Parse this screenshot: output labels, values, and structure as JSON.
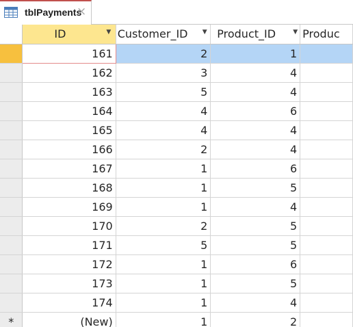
{
  "tab": {
    "label": "tblPayments",
    "close_symbol": "×",
    "icon": "table-icon"
  },
  "columns": [
    {
      "label": "ID"
    },
    {
      "label": "Customer_ID"
    },
    {
      "label": "Product_ID"
    },
    {
      "label": "Produc"
    }
  ],
  "rows": [
    {
      "id": "161",
      "customer_id": "2",
      "product_id": "1"
    },
    {
      "id": "162",
      "customer_id": "3",
      "product_id": "4"
    },
    {
      "id": "163",
      "customer_id": "5",
      "product_id": "4"
    },
    {
      "id": "164",
      "customer_id": "4",
      "product_id": "6"
    },
    {
      "id": "165",
      "customer_id": "4",
      "product_id": "4"
    },
    {
      "id": "166",
      "customer_id": "2",
      "product_id": "4"
    },
    {
      "id": "167",
      "customer_id": "1",
      "product_id": "6"
    },
    {
      "id": "168",
      "customer_id": "1",
      "product_id": "5"
    },
    {
      "id": "169",
      "customer_id": "1",
      "product_id": "4"
    },
    {
      "id": "170",
      "customer_id": "2",
      "product_id": "5"
    },
    {
      "id": "171",
      "customer_id": "5",
      "product_id": "5"
    },
    {
      "id": "172",
      "customer_id": "1",
      "product_id": "6"
    },
    {
      "id": "173",
      "customer_id": "1",
      "product_id": "5"
    },
    {
      "id": "174",
      "customer_id": "1",
      "product_id": "4"
    }
  ],
  "new_row": {
    "marker": "*",
    "id": "(New)",
    "customer_id": "1",
    "product_id": "2"
  },
  "colors": {
    "tab_accent": "#c0504d",
    "header_active": "#fde68f",
    "current_row_highlight": "#b4d5f6",
    "record_selector_current": "#f7c03e"
  }
}
